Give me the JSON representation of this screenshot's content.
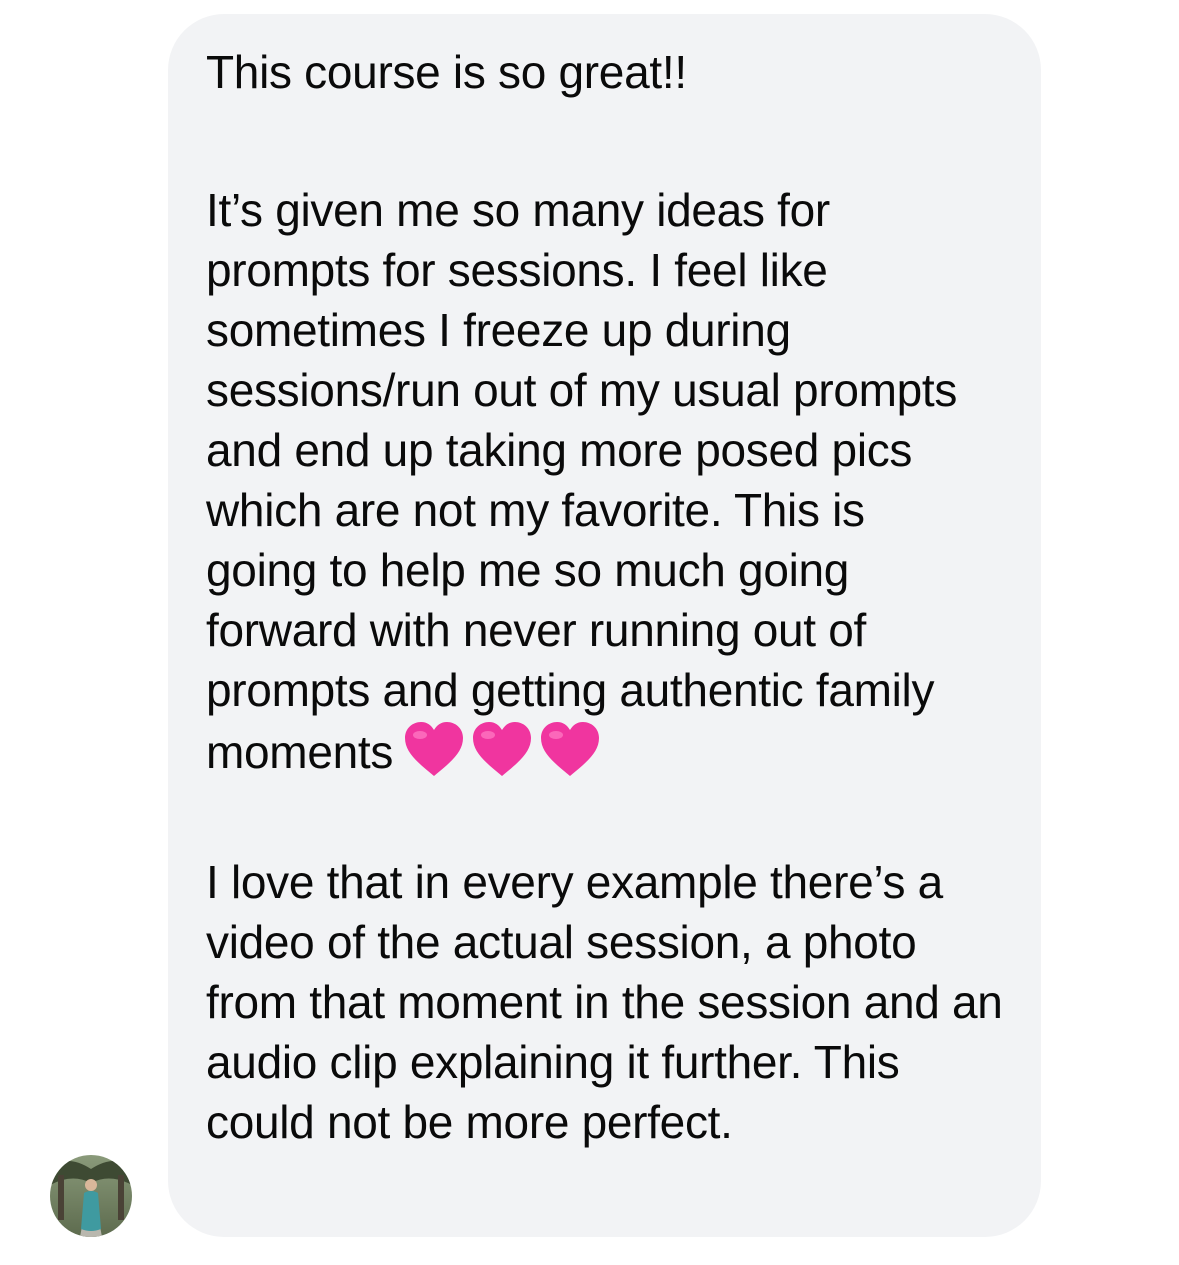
{
  "message": {
    "paragraphs": [
      "This course is so great!!",
      "It’s given me so many ideas for prompts for sessions. I feel like sometimes I freeze up during sessions/run out of my usual prompts and end up taking more posed pics which are not my favorite. This is going to help me so much going forward with never running out of prompts and getting authentic family moments",
      "I love that in every example there’s a video of the actual session, a photo from that moment in the session and an audio clip explaining it further. This could not be more perfect."
    ],
    "emoji": [
      "pink-heart",
      "pink-heart",
      "pink-heart"
    ],
    "bubble_color": "#f2f3f5",
    "text_color": "#0a0a0a",
    "heart_color": "#f0359f"
  },
  "avatar": {
    "icon": "profile-photo"
  }
}
